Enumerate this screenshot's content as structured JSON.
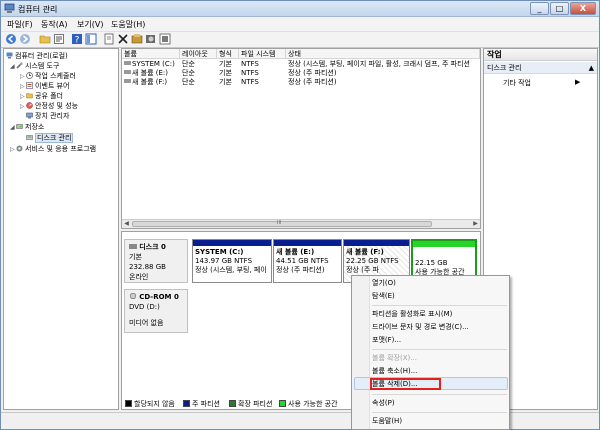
{
  "window": {
    "title": "컴퓨터 관리",
    "min": "_",
    "max": "□",
    "close": "X"
  },
  "menu": [
    "파일(F)",
    "동작(A)",
    "보기(V)",
    "도움말(H)"
  ],
  "toolbar_icons": [
    "back-icon",
    "forward-icon",
    "folder-icon",
    "properties-icon",
    "help-icon",
    "view-icon",
    "export-icon",
    "delete-icon",
    "refresh-icon",
    "search-icon",
    "zoom-icon"
  ],
  "tree": {
    "root": "컴퓨터 관리(로컬)",
    "items": [
      "시스템 도구",
      "작업 스케줄러",
      "이벤트 뷰어",
      "공유 폴더",
      "안정성 및 성능",
      "장치 관리자",
      "저장소",
      "디스크 관리",
      "서비스 및 응용 프로그램"
    ]
  },
  "volumes": {
    "columns": [
      "볼륨",
      "레이아웃",
      "형식",
      "파일 시스템",
      "상태"
    ],
    "rows": [
      [
        "SYSTEM (C:)",
        "단순",
        "기본",
        "NTFS",
        "정상 (시스템, 부팅, 페이지 파일, 활성, 크래시 덤프, 주 파티션"
      ],
      [
        "새 볼륨 (E:)",
        "단순",
        "기본",
        "NTFS",
        "정상 (주 파티션)"
      ],
      [
        "새 볼륨 (F:)",
        "단순",
        "기본",
        "NTFS",
        "정상 (주 파티션)"
      ]
    ],
    "scroll_left": "◀",
    "scroll_right": "▶",
    "scroll_mark": "III"
  },
  "disks": {
    "disk0": {
      "name": "디스크 0",
      "type": "기본",
      "size": "232.88 GB",
      "status": "온라인"
    },
    "partitions": [
      {
        "name": "SYSTEM  (C:)",
        "size": "143.97 GB NTFS",
        "status": "정상 (시스템, 부팅, 페이"
      },
      {
        "name": "새 볼륨  (E:)",
        "size": "44.51 GB NTFS",
        "status": "정상 (주 파티션)"
      },
      {
        "name": "새 볼륨  (F:)",
        "size": "22.25 GB NTFS",
        "status": "정상 (주 파"
      },
      {
        "name": "",
        "size": "22.15 GB",
        "status": "사용 가능한 공간"
      }
    ],
    "cdrom": {
      "name": "CD-ROM 0",
      "drive": "DVD (D:)",
      "status": "미디어 없음"
    },
    "colors": {
      "primary": "#0a1f8f",
      "free": "#28d428",
      "unallocated": "#000000",
      "extended": "#2c7a2c"
    }
  },
  "legend": [
    "할당되지 않음",
    "주 파티션",
    "확장 파티션",
    "사용 가능한 공간"
  ],
  "actions": {
    "title": "작업",
    "section": "디스크 관리",
    "more": "기타 작업",
    "caret_up": "▲",
    "caret_right": "▶"
  },
  "context_menu": {
    "items": [
      {
        "label": "열기(O)",
        "disabled": false
      },
      {
        "label": "탐색(E)",
        "disabled": false
      },
      {
        "label": "파티션을 활성화로 표시(M)",
        "disabled": false
      },
      {
        "label": "드라이브 문자 및 경로 변경(C)...",
        "disabled": false
      },
      {
        "label": "포맷(F)...",
        "disabled": false
      },
      {
        "label": "볼륨 확장(X)...",
        "disabled": true
      },
      {
        "label": "볼륨 축소(H)...",
        "disabled": false
      },
      {
        "label": "볼륨 삭제(D)...",
        "disabled": false
      },
      {
        "label": "속성(P)",
        "disabled": false
      },
      {
        "label": "도움말(H)",
        "disabled": false
      }
    ]
  }
}
